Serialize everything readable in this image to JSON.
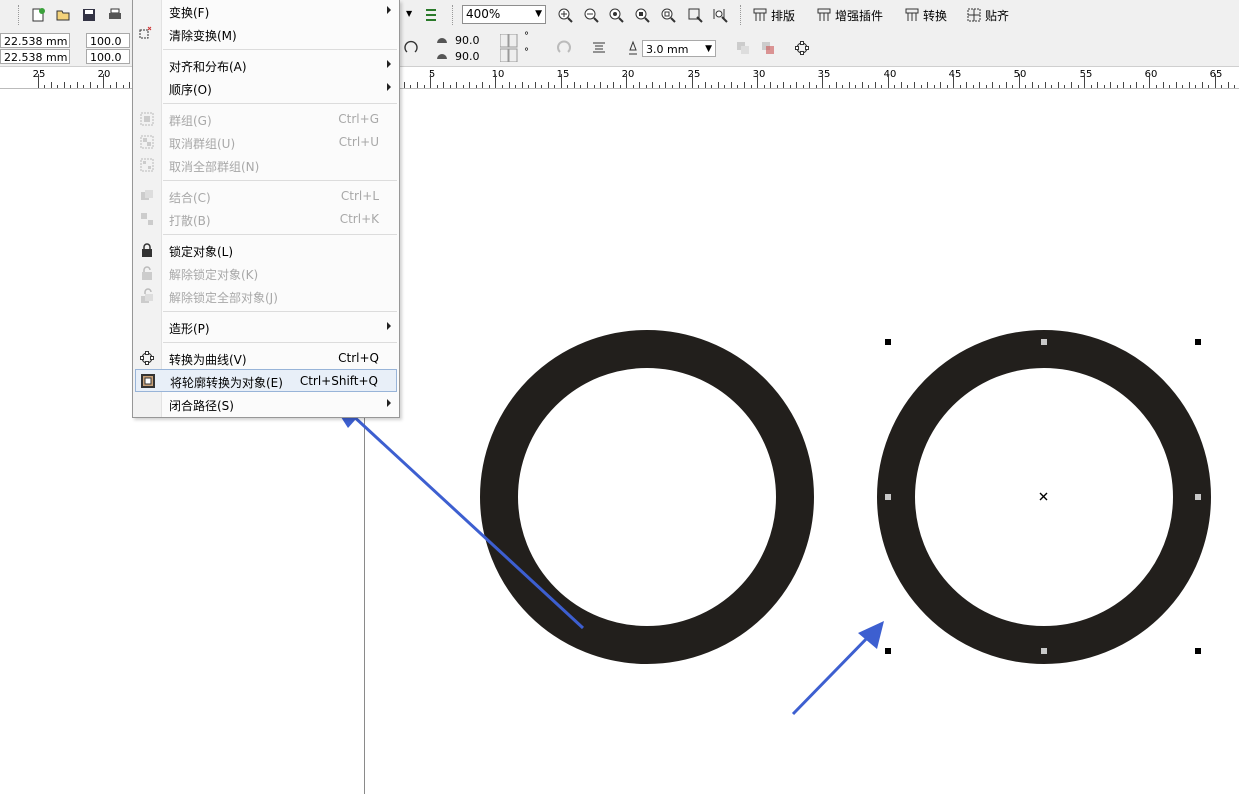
{
  "toolbar": {
    "zoom": "400%",
    "plugins": [
      {
        "label": "排版"
      },
      {
        "label": "增强插件"
      },
      {
        "label": "转换"
      },
      {
        "label": "贴齐"
      }
    ]
  },
  "property_bar": {
    "x": "22.538 mm",
    "y": "22.538 mm",
    "scale_x": "100.0",
    "scale_y": "100.0",
    "angle_1": "90.0",
    "angle_2": "90.0",
    "outline_width": "3.0 mm"
  },
  "ruler": {
    "labels": [
      "25",
      "20",
      "5",
      "10",
      "15",
      "20",
      "25",
      "30",
      "35",
      "40",
      "45",
      "50",
      "55",
      "60",
      "65"
    ]
  },
  "menu": {
    "items": [
      {
        "label": "变换(F)",
        "shortcut": "",
        "submenu": true,
        "disabled": false
      },
      {
        "label": "清除变换(M)",
        "shortcut": "",
        "submenu": false,
        "disabled": false
      },
      {
        "label": "对齐和分布(A)",
        "shortcut": "",
        "submenu": true,
        "disabled": false
      },
      {
        "label": "顺序(O)",
        "shortcut": "",
        "submenu": true,
        "disabled": false
      },
      {
        "label": "群组(G)",
        "shortcut": "Ctrl+G",
        "submenu": false,
        "disabled": true
      },
      {
        "label": "取消群组(U)",
        "shortcut": "Ctrl+U",
        "submenu": false,
        "disabled": true
      },
      {
        "label": "取消全部群组(N)",
        "shortcut": "",
        "submenu": false,
        "disabled": true
      },
      {
        "label": "结合(C)",
        "shortcut": "Ctrl+L",
        "submenu": false,
        "disabled": true
      },
      {
        "label": "打散(B)",
        "shortcut": "Ctrl+K",
        "submenu": false,
        "disabled": true
      },
      {
        "label": "锁定对象(L)",
        "shortcut": "",
        "submenu": false,
        "disabled": false
      },
      {
        "label": "解除锁定对象(K)",
        "shortcut": "",
        "submenu": false,
        "disabled": true
      },
      {
        "label": "解除锁定全部对象(J)",
        "shortcut": "",
        "submenu": false,
        "disabled": true
      },
      {
        "label": "造形(P)",
        "shortcut": "",
        "submenu": true,
        "disabled": false
      },
      {
        "label": "转换为曲线(V)",
        "shortcut": "Ctrl+Q",
        "submenu": false,
        "disabled": false
      },
      {
        "label": "将轮廓转换为对象(E)",
        "shortcut": "Ctrl+Shift+Q",
        "submenu": false,
        "disabled": false,
        "highlighted": true
      },
      {
        "label": "闭合路径(S)",
        "shortcut": "",
        "submenu": true,
        "disabled": false
      }
    ]
  },
  "colors": {
    "ring": "#221f1c",
    "arrow": "#3d5fd0",
    "menu_highlight": "#e8eff8"
  }
}
